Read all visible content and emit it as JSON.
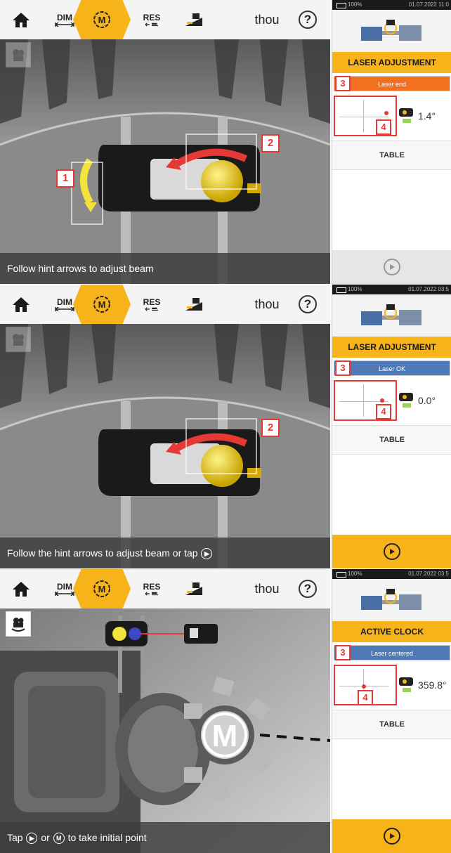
{
  "toolbar": {
    "dim_label": "DIM",
    "measure_badge": "M",
    "res_label": "RES",
    "unit_label": "thou",
    "help_label": "?"
  },
  "panels": [
    {
      "hint_text": "Follow hint arrows to adjust beam",
      "battery": "100%",
      "datetime": "01.07.2022 11:0",
      "right_title": "LASER ADJUSTMENT",
      "state_label": "Laser end",
      "state_color": "#f37021",
      "angle": "1.4°",
      "table_label": "TABLE",
      "callouts": [
        "1",
        "2",
        "3",
        "4"
      ],
      "play_enabled": false
    },
    {
      "hint_text": "Follow the hint arrows to adjust beam or tap",
      "battery": "100%",
      "datetime": "01.07.2022 03:5",
      "right_title": "LASER ADJUSTMENT",
      "state_label": "Laser OK",
      "state_color": "#4f79b7",
      "angle": "0.0°",
      "table_label": "TABLE",
      "callouts": [
        "2",
        "3",
        "4"
      ],
      "play_enabled": true
    },
    {
      "hint_prefix": "Tap",
      "hint_mid": "or",
      "hint_suffix": "to take initial point",
      "battery": "100%",
      "datetime": "01.07.2022 03:5",
      "right_title": "ACTIVE CLOCK",
      "state_label": "Laser centered",
      "state_color": "#4f79b7",
      "angle": "359.8°",
      "table_label": "TABLE",
      "callouts": [
        "3",
        "4"
      ],
      "m_badge": "M",
      "play_enabled": true
    }
  ],
  "colors": {
    "accent": "#f6b31a",
    "callout": "#e53935",
    "laser_end": "#f37021",
    "laser_ok": "#4f79b7"
  }
}
